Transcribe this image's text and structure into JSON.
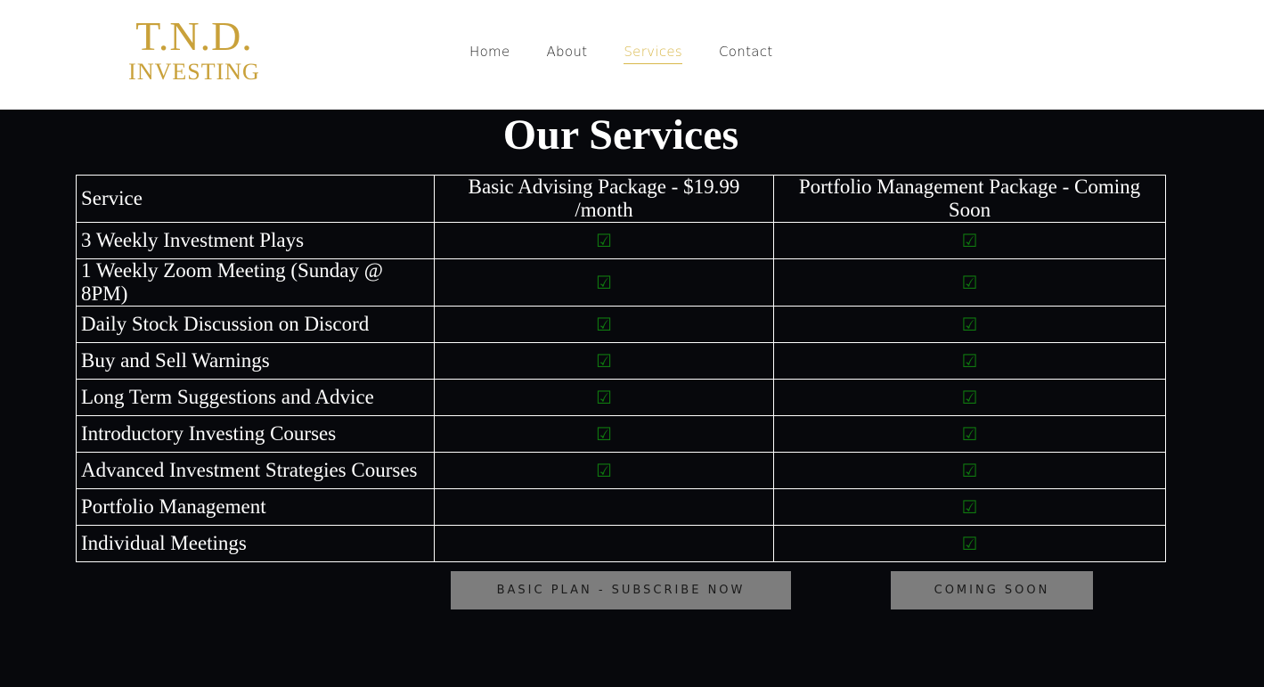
{
  "logo": {
    "line1": "T.N.D.",
    "line2": "INVESTING"
  },
  "nav": [
    {
      "label": "Home",
      "active": false
    },
    {
      "label": "About",
      "active": false
    },
    {
      "label": "Services",
      "active": true
    },
    {
      "label": "Contact",
      "active": false
    }
  ],
  "title": "Our Services",
  "table": {
    "headers": [
      "Service",
      "Basic Advising Package - $19.99 /month",
      "Portfolio Management Package - Coming Soon"
    ],
    "check_symbol": "☑",
    "rows": [
      {
        "service": "3 Weekly Investment Plays",
        "basic": "☑",
        "portfolio": "☑"
      },
      {
        "service": "1 Weekly Zoom Meeting (Sunday @ 8PM)",
        "basic": "☑",
        "portfolio": "☑"
      },
      {
        "service": "Daily Stock Discussion on Discord",
        "basic": "☑",
        "portfolio": "☑"
      },
      {
        "service": "Buy and Sell Warnings",
        "basic": "☑",
        "portfolio": "☑"
      },
      {
        "service": "Long Term Suggestions and Advice",
        "basic": "☑",
        "portfolio": "☑"
      },
      {
        "service": "Introductory Investing Courses",
        "basic": "☑",
        "portfolio": "☑"
      },
      {
        "service": "Advanced Investment Strategies Courses",
        "basic": "☑",
        "portfolio": "☑"
      },
      {
        "service": "Portfolio Management",
        "basic": "",
        "portfolio": "☑"
      },
      {
        "service": "Individual Meetings",
        "basic": "",
        "portfolio": "☑"
      }
    ]
  },
  "buttons": {
    "basic": "BASIC PLAN - SUBSCRIBE NOW",
    "soon": "COMING SOON"
  },
  "colors": {
    "gold": "#c9a13a",
    "check_green": "#0f7a0f",
    "background": "#07080c",
    "button_gray": "#7d7d7d"
  }
}
